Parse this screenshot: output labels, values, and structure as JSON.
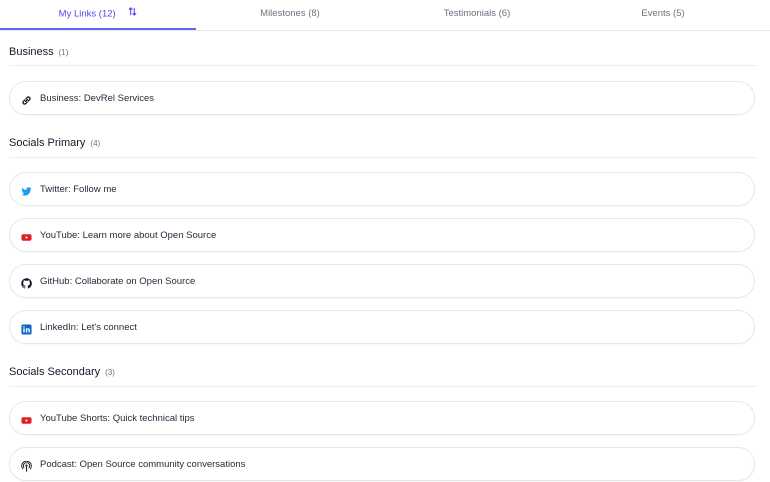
{
  "tabs": [
    {
      "label": "My Links (12)",
      "active": true
    },
    {
      "label": "Milestones (8)"
    },
    {
      "label": "Testimonials (6)"
    },
    {
      "label": "Events (5)"
    }
  ],
  "colors": {
    "accent": "#4f46e5",
    "twitter": "#1d9bf0",
    "youtube": "#e11d24",
    "linkedin": "#0a66c2"
  },
  "sections": [
    {
      "title": "Business",
      "count": "(1)",
      "links": [
        {
          "label": "Business: DevRel Services",
          "icon": "link-icon"
        }
      ]
    },
    {
      "title": "Socials Primary",
      "count": "(4)",
      "links": [
        {
          "label": "Twitter: Follow me",
          "icon": "twitter-icon"
        },
        {
          "label": "YouTube: Learn more about Open Source",
          "icon": "youtube-icon"
        },
        {
          "label": "GitHub: Collaborate on Open Source",
          "icon": "github-icon"
        },
        {
          "label": "LinkedIn: Let's connect",
          "icon": "linkedin-icon"
        }
      ]
    },
    {
      "title": "Socials Secondary",
      "count": "(3)",
      "links": [
        {
          "label": "YouTube Shorts: Quick technical tips",
          "icon": "youtube-icon"
        },
        {
          "label": "Podcast: Open Source community conversations",
          "icon": "podcast-icon"
        }
      ]
    }
  ]
}
